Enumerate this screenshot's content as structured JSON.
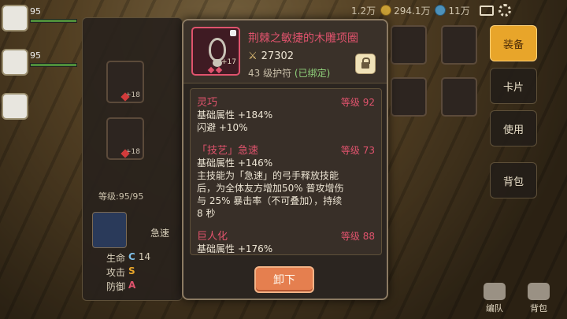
{
  "topbar": {
    "coins": "1.2万",
    "gold": "294.1万",
    "gems": "11万"
  },
  "party": [
    {
      "level": "95"
    },
    {
      "level": "95"
    },
    {
      "level": ""
    }
  ],
  "left_panel": {
    "slot1_tag": "+18",
    "slot2_tag": "+18",
    "level_text": "等级:95/95",
    "skill_name": "急速",
    "stats": [
      {
        "label": "生命",
        "grade": "C",
        "value": "14"
      },
      {
        "label": "攻击",
        "grade": "S",
        "value": ""
      },
      {
        "label": "防御",
        "grade": "A",
        "value": ""
      }
    ]
  },
  "right_tabs": {
    "equip": "装备",
    "card": "卡片",
    "use": "使用",
    "bag": "背包",
    "team": "编队",
    "bag_bottom": "背包"
  },
  "colors": {
    "rare_pink": "#e0536d",
    "button_orange": "#e57f4f",
    "tab_active": "#e8a52a"
  },
  "popup": {
    "item_name": "荆棘之敏捷的木雕项圈",
    "item_plus": "+17",
    "power": "27302",
    "sub_level": "43 级护符",
    "sub_bound": "(已绑定)",
    "affixes": [
      {
        "name": "灵巧",
        "level": "等级 92",
        "lines": [
          "基础属性 +184%",
          "闪避 +10%"
        ]
      },
      {
        "name": "「技艺」急速",
        "level": "等级 73",
        "lines": [
          "基础属性 +146%",
          "主技能为「急速」的弓手释放技能",
          "后，为全体友方增加50% 普攻增伤",
          "与 25% 暴击率（不可叠加），持续",
          "8 秒"
        ]
      },
      {
        "name": "巨人化",
        "level": "等级 88",
        "lines": [
          "基础属性 +176%"
        ]
      }
    ],
    "unequip_label": "卸下"
  }
}
